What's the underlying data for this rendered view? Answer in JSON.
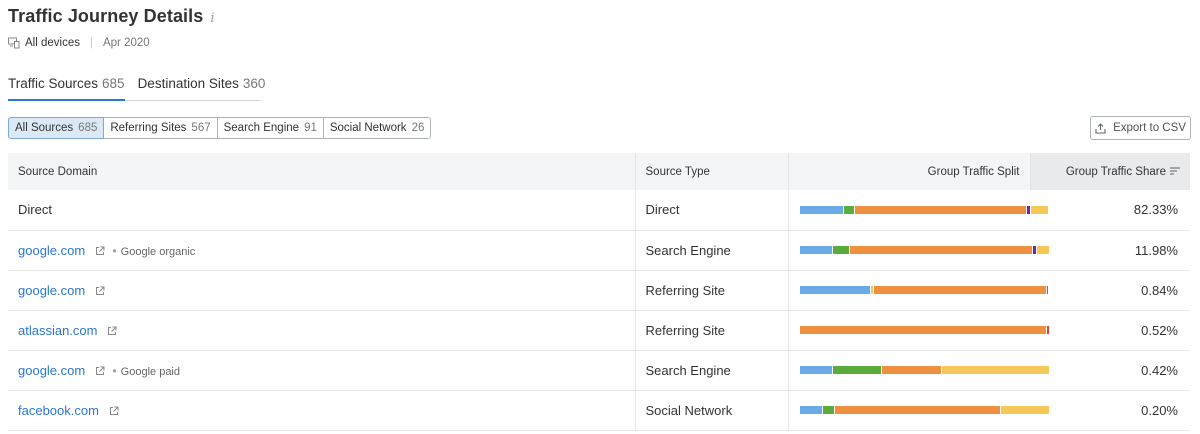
{
  "header": {
    "title": "Traffic Journey Details",
    "info_glyph": "i",
    "device": "All devices",
    "date": "Apr 2020"
  },
  "tabs": [
    {
      "label": "Traffic Sources",
      "count": "685",
      "active": true
    },
    {
      "label": "Destination Sites",
      "count": "360",
      "active": false
    }
  ],
  "filters": [
    {
      "label": "All Sources",
      "count": "685",
      "active": true
    },
    {
      "label": "Referring Sites",
      "count": "567",
      "active": false
    },
    {
      "label": "Search Engine",
      "count": "91",
      "active": false
    },
    {
      "label": "Social Network",
      "count": "26",
      "active": false
    }
  ],
  "export_label": "Export to CSV",
  "table": {
    "columns": [
      "Source Domain",
      "Source Type",
      "Group Traffic Split",
      "Group Traffic Share"
    ],
    "sorted_column": "Group Traffic Share",
    "split_colors": {
      "blue": "#6aaae8",
      "green": "#5aaa3c",
      "orange": "#ee9040",
      "purple": "#6a2da0",
      "yellow": "#f6c85a",
      "red": "#d8463a"
    },
    "rows": [
      {
        "domain": "Direct",
        "link": false,
        "sub": "",
        "type": "Direct",
        "share": "82.33%",
        "split": [
          {
            "c": "blue",
            "v": 17.5
          },
          {
            "c": "green",
            "v": 4
          },
          {
            "c": "orange",
            "v": 69.5
          },
          {
            "c": "purple",
            "v": 1.2
          },
          {
            "c": "yellow",
            "v": 7
          }
        ]
      },
      {
        "domain": "google.com",
        "link": true,
        "sub": "Google organic",
        "type": "Search Engine",
        "share": "11.98%",
        "split": [
          {
            "c": "blue",
            "v": 13
          },
          {
            "c": "green",
            "v": 6.5
          },
          {
            "c": "orange",
            "v": 73.5
          },
          {
            "c": "purple",
            "v": 1.5
          },
          {
            "c": "yellow",
            "v": 4.5
          }
        ]
      },
      {
        "domain": "google.com",
        "link": true,
        "sub": "",
        "type": "Referring Site",
        "share": "0.84%",
        "split": [
          {
            "c": "blue",
            "v": 28.5
          },
          {
            "c": "yellow",
            "v": 0.6
          },
          {
            "c": "orange",
            "v": 69.5
          },
          {
            "c": "red",
            "v": 0.6
          }
        ]
      },
      {
        "domain": "atlassian.com",
        "link": true,
        "sub": "",
        "type": "Referring Site",
        "share": "0.52%",
        "split": [
          {
            "c": "orange",
            "v": 99
          },
          {
            "c": "red",
            "v": 0.8
          }
        ]
      },
      {
        "domain": "google.com",
        "link": true,
        "sub": "Google paid",
        "type": "Search Engine",
        "share": "0.42%",
        "split": [
          {
            "c": "blue",
            "v": 13
          },
          {
            "c": "green",
            "v": 19.5
          },
          {
            "c": "orange",
            "v": 24
          },
          {
            "c": "yellow",
            "v": 43
          }
        ]
      },
      {
        "domain": "facebook.com",
        "link": true,
        "sub": "",
        "type": "Social Network",
        "share": "0.20%",
        "split": [
          {
            "c": "blue",
            "v": 9
          },
          {
            "c": "green",
            "v": 4.5
          },
          {
            "c": "orange",
            "v": 66
          },
          {
            "c": "yellow",
            "v": 19
          }
        ]
      }
    ]
  }
}
